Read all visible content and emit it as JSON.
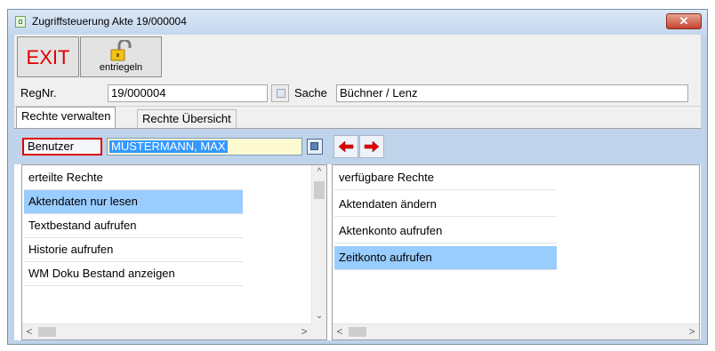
{
  "window": {
    "title": "Zugriffsteuerung Akte 19/000004",
    "close_symbol": "✕"
  },
  "toolbar": {
    "exit_label": "EXIT",
    "unlock_label": "entriegeln",
    "unlock_icon": "padlock-open-icon"
  },
  "record": {
    "regnr_label": "RegNr.",
    "regnr_value": "19/000004",
    "sache_label": "Sache",
    "sache_value": "Büchner / Lenz"
  },
  "tabs": [
    {
      "label": "Rechte verwalten",
      "active": true
    },
    {
      "label": "Rechte Übersicht",
      "active": false
    }
  ],
  "user": {
    "label": "Benutzer",
    "value": "MUSTERMANN, MAX"
  },
  "granted": {
    "items": [
      {
        "label": "erteilte Rechte",
        "selected": false
      },
      {
        "label": "Aktendaten nur lesen",
        "selected": true
      },
      {
        "label": "Textbestand aufrufen",
        "selected": false
      },
      {
        "label": "Historie aufrufen",
        "selected": false
      },
      {
        "label": "WM Doku Bestand anzeigen",
        "selected": false
      }
    ]
  },
  "available": {
    "items": [
      {
        "label": "verfügbare Rechte",
        "selected": false
      },
      {
        "label": "Aktendaten ändern",
        "selected": false
      },
      {
        "label": "Aktenkonto aufrufen",
        "selected": false
      },
      {
        "label": "Zeitkonto aufrufen",
        "selected": true
      }
    ]
  },
  "scroll_glyphs": {
    "up": "^",
    "down": "⌄",
    "left": "<",
    "right": ">"
  },
  "colors": {
    "exit_red": "#e00000",
    "selection_blue": "#99ccff",
    "user_highlight": "#3399ff",
    "title_bar": "#c4d7ee",
    "close_red": "#c4422d"
  }
}
